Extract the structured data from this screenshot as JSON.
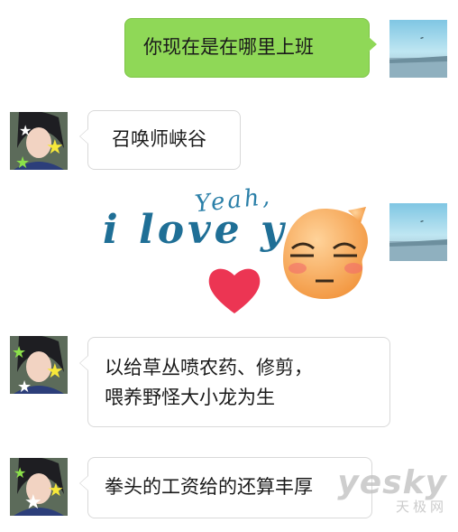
{
  "conversation": {
    "messages": [
      {
        "sender": "me",
        "type": "text",
        "text": "你现在是在哪里上班"
      },
      {
        "sender": "friend",
        "type": "text",
        "text": "召唤师峡谷"
      },
      {
        "sender": "me",
        "type": "sticker",
        "sticker_text": [
          "Yeah,",
          "i love y"
        ],
        "sticker_icons": [
          "heart-icon",
          "smirk-emoji-icon"
        ]
      },
      {
        "sender": "friend",
        "type": "text",
        "lines": [
          "以给草丛喷农药、修剪，",
          "喂养野怪大小龙为生"
        ]
      },
      {
        "sender": "friend",
        "type": "text",
        "text": "拳头的工资给的还算丰厚"
      }
    ]
  },
  "watermark": {
    "brand": "yesky",
    "sub": "天极网"
  },
  "colors": {
    "outgoing_bubble": "#8fd857",
    "incoming_bubble": "#ffffff",
    "bubble_border": "#d9d9d9"
  }
}
